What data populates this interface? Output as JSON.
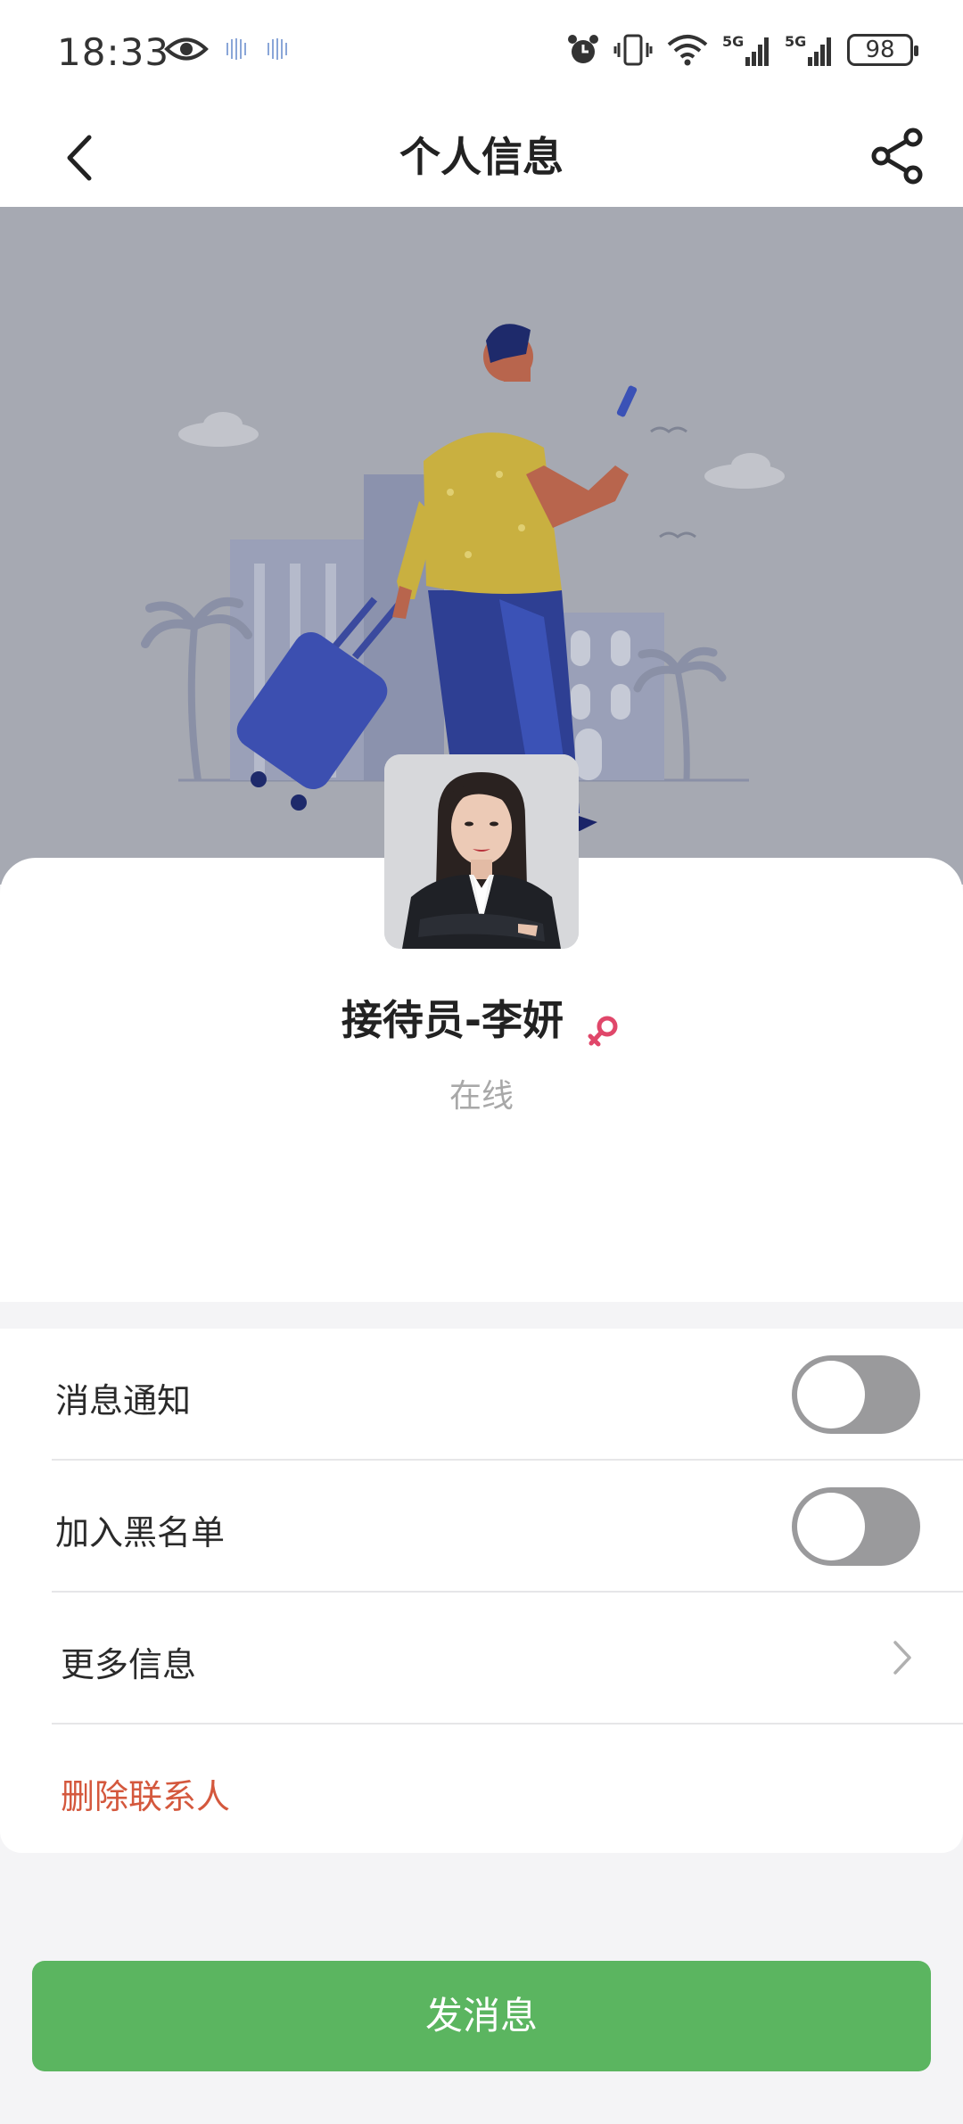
{
  "status_bar": {
    "time": "18:33",
    "battery": "98",
    "network": "5G"
  },
  "navbar": {
    "title": "个人信息",
    "back_icon": "chevron-left-icon",
    "share_icon": "share-icon"
  },
  "profile": {
    "name": "接待员-李妍",
    "gender_icon": "female-icon",
    "status": "在线"
  },
  "settings": {
    "notify_label": "消息通知",
    "notify_on": false,
    "blacklist_label": "加入黑名单",
    "blacklist_on": false,
    "more_label": "更多信息",
    "delete_label": "删除联系人"
  },
  "actions": {
    "send_message": "发消息"
  },
  "colors": {
    "primary_green": "#5bb560",
    "danger": "#d4583d",
    "gender_pink": "#e0476a",
    "banner_bg": "#a6a9b2"
  }
}
